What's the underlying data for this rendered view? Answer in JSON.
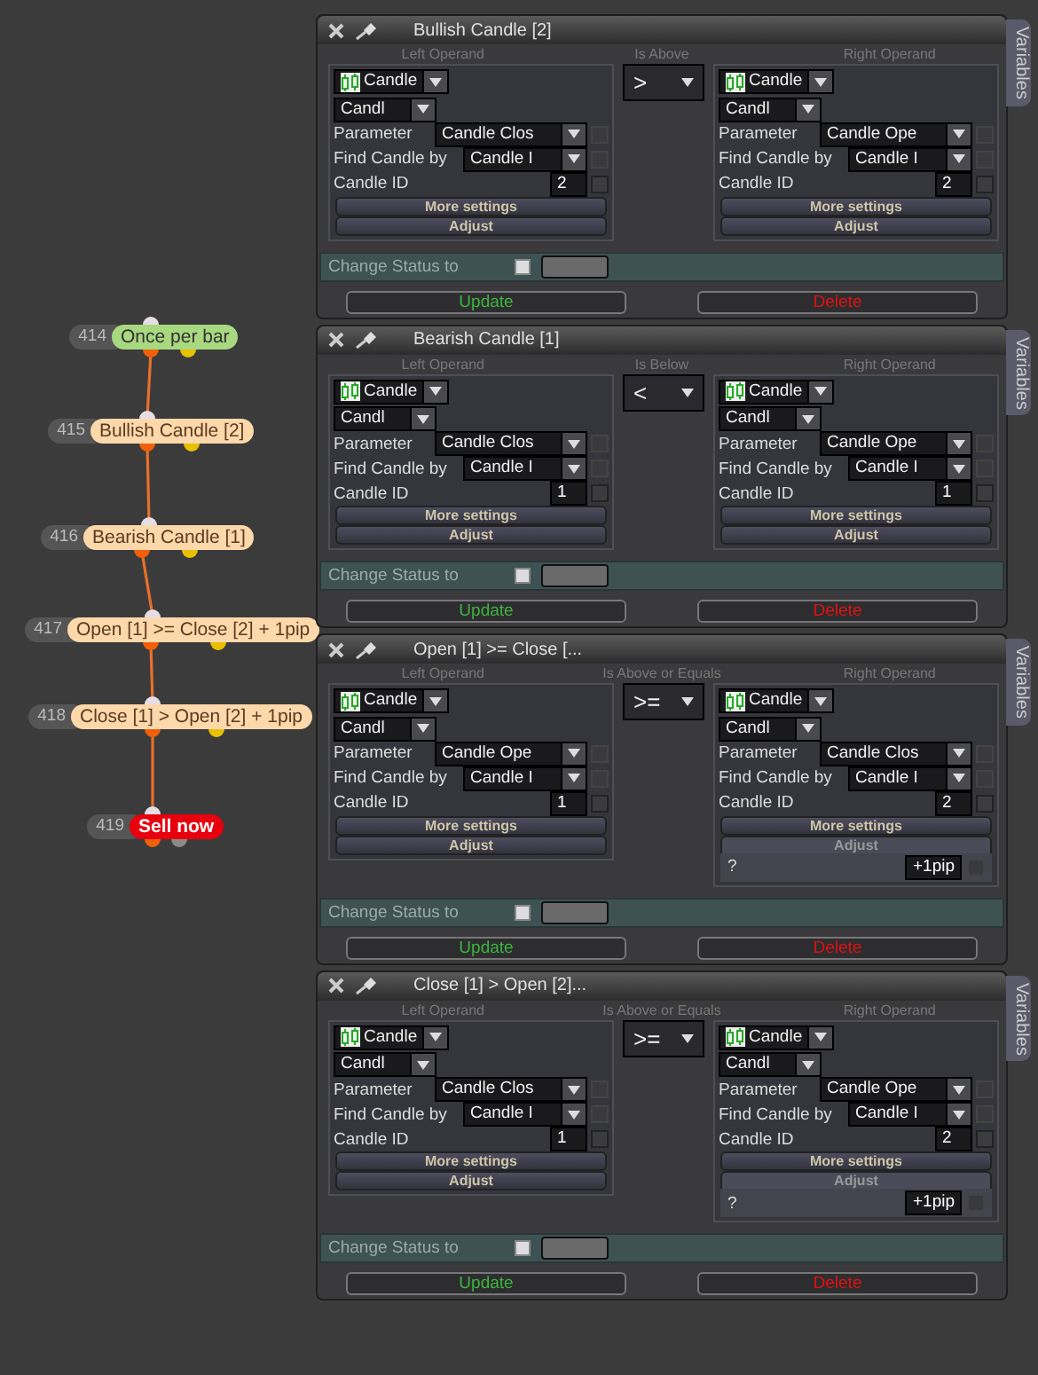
{
  "nodes": [
    {
      "number": "414",
      "label": "Once per bar",
      "kind": "start"
    },
    {
      "number": "415",
      "label": "Bullish Candle [2]",
      "kind": "condition"
    },
    {
      "number": "416",
      "label": "Bearish Candle [1]",
      "kind": "condition"
    },
    {
      "number": "417",
      "label": "Open [1] >= Close [2] + 1pip",
      "kind": "condition"
    },
    {
      "number": "418",
      "label": "Close [1] > Open [2] + 1pip",
      "kind": "condition"
    },
    {
      "number": "419",
      "label": "Sell now",
      "kind": "action"
    }
  ],
  "panels": [
    {
      "title": "Bullish Candle [2]",
      "tab": "Variables",
      "operator": {
        "header": "Is Above",
        "symbol": ">"
      },
      "left": {
        "header": "Left Operand",
        "source": "Candle",
        "subtype": "Candl",
        "parameter": {
          "label": "Parameter",
          "value": "Candle Clos",
          "checked": false
        },
        "find_by": {
          "label": "Find Candle by",
          "value": "Candle I",
          "checked": false
        },
        "candle_id": {
          "label": "Candle ID",
          "value": "2",
          "checked": false
        },
        "more_settings": "More settings",
        "adjust": "Adjust",
        "adjust_expanded": false
      },
      "right": {
        "header": "Right Operand",
        "source": "Candle",
        "subtype": "Candl",
        "parameter": {
          "label": "Parameter",
          "value": "Candle Ope",
          "checked": false
        },
        "find_by": {
          "label": "Find Candle by",
          "value": "Candle I",
          "checked": false
        },
        "candle_id": {
          "label": "Candle ID",
          "value": "2",
          "checked": false
        },
        "more_settings": "More settings",
        "adjust": "Adjust",
        "adjust_expanded": false
      },
      "status": {
        "label": "Change Status to",
        "checked": false
      },
      "update": "Update",
      "delete": "Delete"
    },
    {
      "title": "Bearish Candle [1]",
      "tab": "Variables",
      "operator": {
        "header": "Is Below",
        "symbol": "<"
      },
      "left": {
        "header": "Left Operand",
        "source": "Candle",
        "subtype": "Candl",
        "parameter": {
          "label": "Parameter",
          "value": "Candle Clos",
          "checked": false
        },
        "find_by": {
          "label": "Find Candle by",
          "value": "Candle I",
          "checked": false
        },
        "candle_id": {
          "label": "Candle ID",
          "value": "1",
          "checked": false
        },
        "more_settings": "More settings",
        "adjust": "Adjust",
        "adjust_expanded": false
      },
      "right": {
        "header": "Right Operand",
        "source": "Candle",
        "subtype": "Candl",
        "parameter": {
          "label": "Parameter",
          "value": "Candle Ope",
          "checked": false
        },
        "find_by": {
          "label": "Find Candle by",
          "value": "Candle I",
          "checked": false
        },
        "candle_id": {
          "label": "Candle ID",
          "value": "1",
          "checked": false
        },
        "more_settings": "More settings",
        "adjust": "Adjust",
        "adjust_expanded": false
      },
      "status": {
        "label": "Change Status to",
        "checked": false
      },
      "update": "Update",
      "delete": "Delete"
    },
    {
      "title": "Open [1] >= Close [...",
      "tab": "Variables",
      "operator": {
        "header": "Is Above or Equals",
        "symbol": ">="
      },
      "left": {
        "header": "Left Operand",
        "source": "Candle",
        "subtype": "Candl",
        "parameter": {
          "label": "Parameter",
          "value": "Candle Ope",
          "checked": false
        },
        "find_by": {
          "label": "Find Candle by",
          "value": "Candle I",
          "checked": false
        },
        "candle_id": {
          "label": "Candle ID",
          "value": "1",
          "checked": false
        },
        "more_settings": "More settings",
        "adjust": "Adjust",
        "adjust_expanded": false
      },
      "right": {
        "header": "Right Operand",
        "source": "Candle",
        "subtype": "Candl",
        "parameter": {
          "label": "Parameter",
          "value": "Candle Clos",
          "checked": false
        },
        "find_by": {
          "label": "Find Candle by",
          "value": "Candle I",
          "checked": false
        },
        "candle_id": {
          "label": "Candle ID",
          "value": "2",
          "checked": false
        },
        "more_settings": "More settings",
        "adjust": "Adjust",
        "adjust_expanded": true,
        "adjust_row": {
          "label": "?",
          "value": "+1pip",
          "checked": false
        }
      },
      "status": {
        "label": "Change Status to",
        "checked": false
      },
      "update": "Update",
      "delete": "Delete"
    },
    {
      "title": "Close [1] > Open [2]...",
      "tab": "Variables",
      "operator": {
        "header": "Is Above or Equals",
        "symbol": ">="
      },
      "left": {
        "header": "Left Operand",
        "source": "Candle",
        "subtype": "Candl",
        "parameter": {
          "label": "Parameter",
          "value": "Candle Clos",
          "checked": false
        },
        "find_by": {
          "label": "Find Candle by",
          "value": "Candle I",
          "checked": false
        },
        "candle_id": {
          "label": "Candle ID",
          "value": "1",
          "checked": false
        },
        "more_settings": "More settings",
        "adjust": "Adjust",
        "adjust_expanded": false
      },
      "right": {
        "header": "Right Operand",
        "source": "Candle",
        "subtype": "Candl",
        "parameter": {
          "label": "Parameter",
          "value": "Candle Ope",
          "checked": false
        },
        "find_by": {
          "label": "Find Candle by",
          "value": "Candle I",
          "checked": false
        },
        "candle_id": {
          "label": "Candle ID",
          "value": "2",
          "checked": false
        },
        "more_settings": "More settings",
        "adjust": "Adjust",
        "adjust_expanded": true,
        "adjust_row": {
          "label": "?",
          "value": "+1pip",
          "checked": false
        }
      },
      "status": {
        "label": "Change Status to",
        "checked": false
      },
      "update": "Update",
      "delete": "Delete"
    }
  ]
}
